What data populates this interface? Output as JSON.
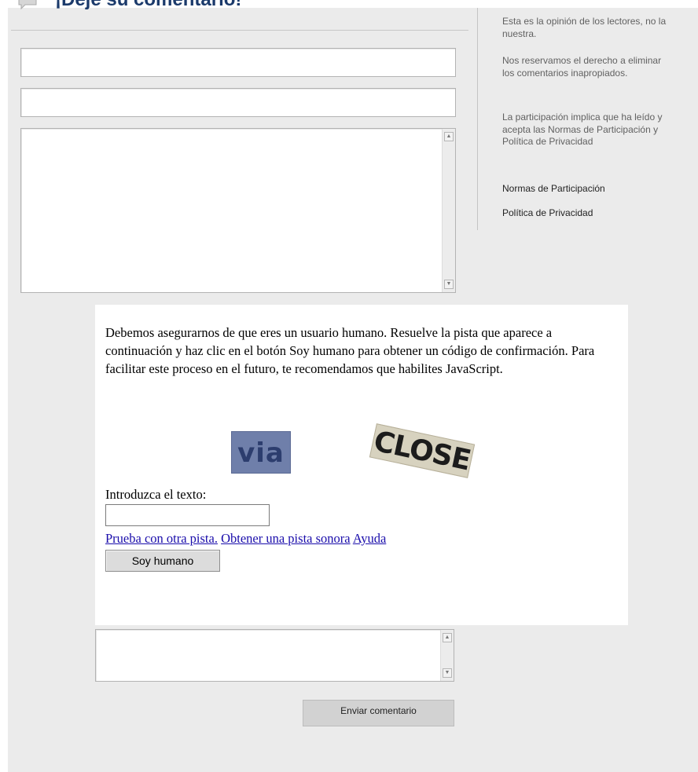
{
  "header": {
    "title": "¡Deje su comentario!"
  },
  "form": {
    "name_value": "",
    "email_value": "",
    "comment_value": "",
    "confirmation_value": "",
    "submit_label": "Enviar comentario"
  },
  "sidebar": {
    "paragraphs": [
      "Esta es la opinión de los lectores, no la nuestra.",
      "Nos reservamos el derecho a eliminar los comentarios inapropiados.",
      "La participación implica que ha leído y acepta las Normas de Participación y Política de Privacidad"
    ],
    "links": [
      "Normas de Participación",
      "Política de Privacidad"
    ]
  },
  "captcha": {
    "instructions": "Debemos asegurarnos de que eres un usuario humano. Resuelve la pista que aparece a continuación y haz clic en el botón Soy humano para obtener un código de confirmación. Para facilitar este proceso en el futuro, te recomendamos que habilites JavaScript.",
    "word1": "via",
    "word2": "CLOSE",
    "input_label": "Introduzca el texto:",
    "input_value": "",
    "links": [
      "Prueba con otra pista.",
      "Obtener una pista sonora",
      "Ayuda"
    ],
    "button_label": "Soy humano"
  }
}
